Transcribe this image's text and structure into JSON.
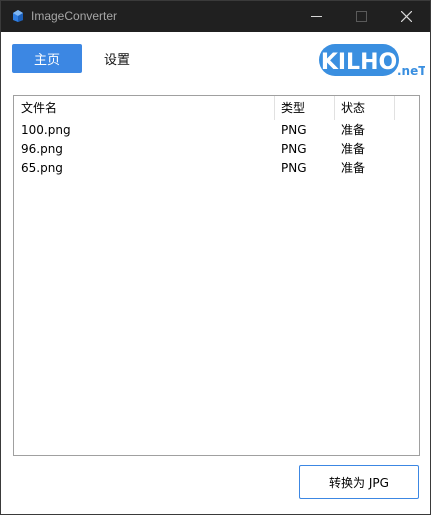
{
  "window": {
    "title": "ImageConverter"
  },
  "nav": {
    "home_label": "主页",
    "settings_label": "设置"
  },
  "logo": {
    "main_text": "KILHO",
    "suffix_text": ".neT"
  },
  "file_list": {
    "columns": [
      "文件名",
      "类型",
      "状态"
    ],
    "rows": [
      [
        "100.png",
        "PNG",
        "准备"
      ],
      [
        "96.png",
        "PNG",
        "准备"
      ],
      [
        "65.png",
        "PNG",
        "准备"
      ]
    ]
  },
  "actions": {
    "convert_label": "转换为 JPG"
  },
  "colors": {
    "accent": "#3c87e3",
    "titlebar": "#202020",
    "logo_blue": "#3a8fe0"
  }
}
